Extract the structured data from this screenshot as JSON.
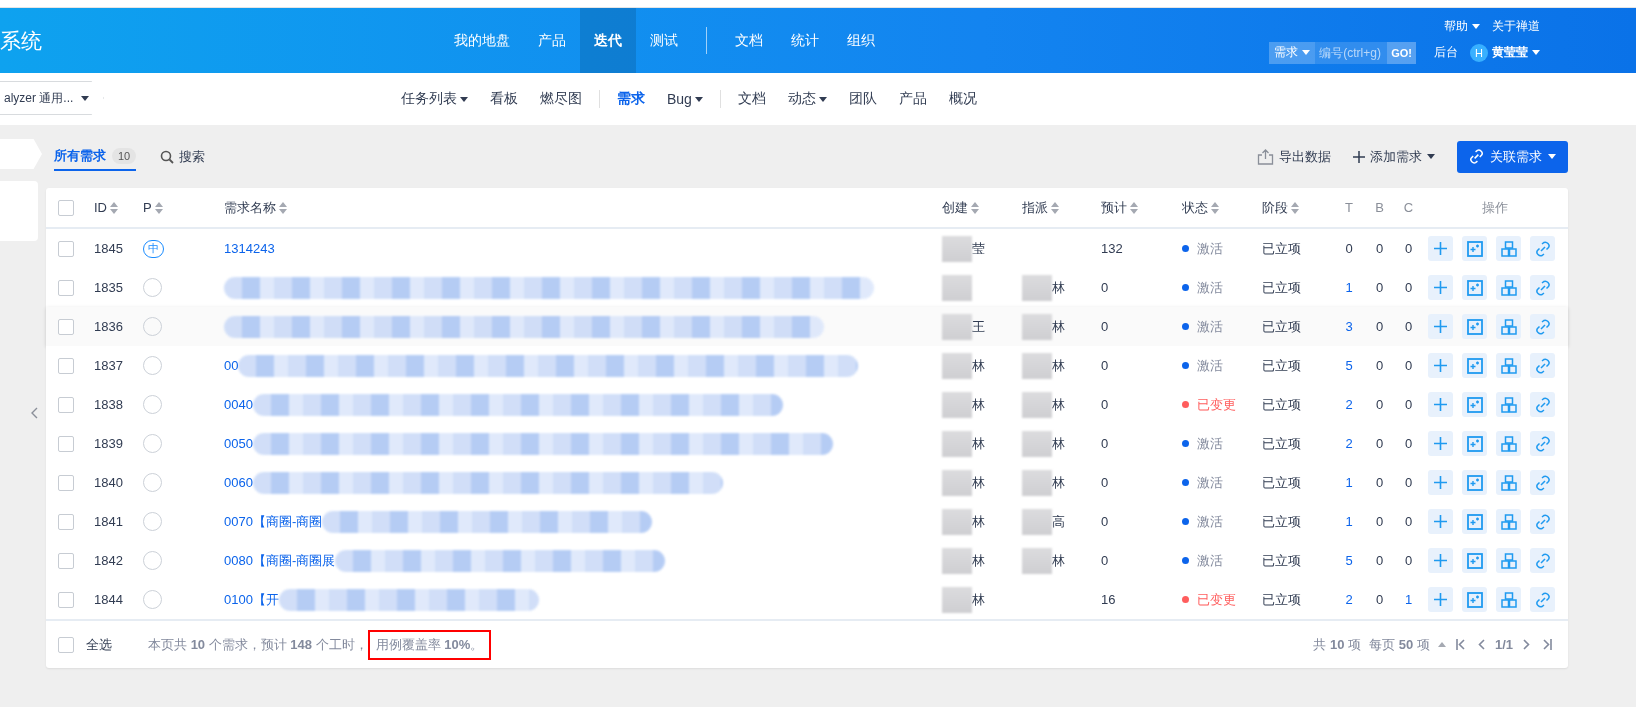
{
  "header": {
    "brand": "系统",
    "nav": [
      {
        "label": "我的地盘",
        "selected": false
      },
      {
        "label": "产品",
        "selected": false
      },
      {
        "label": "迭代",
        "selected": true
      },
      {
        "label": "测试",
        "selected": false
      },
      {
        "kind": "divider"
      },
      {
        "label": "文档",
        "selected": false
      },
      {
        "label": "统计",
        "selected": false
      },
      {
        "label": "组织",
        "selected": false
      }
    ],
    "help": "帮助",
    "about": "关于禅道",
    "search_type": "需求",
    "search": {
      "placeholder": "编号(ctrl+g)"
    },
    "go": "GO!",
    "admin": "后台",
    "avatar": "H",
    "user": "黄莹莹"
  },
  "subnav": {
    "project": "alyzer 通用...",
    "items": [
      {
        "label": "任务列表",
        "dropdown": true,
        "selected": false
      },
      {
        "label": "看板",
        "dropdown": false,
        "selected": false
      },
      {
        "label": "燃尽图",
        "dropdown": false,
        "selected": false
      },
      {
        "kind": "divider"
      },
      {
        "label": "需求",
        "dropdown": false,
        "selected": true
      },
      {
        "label": "Bug",
        "dropdown": true,
        "selected": false
      },
      {
        "kind": "divider"
      },
      {
        "label": "文档",
        "dropdown": false,
        "selected": false
      },
      {
        "label": "动态",
        "dropdown": true,
        "selected": false
      },
      {
        "label": "团队",
        "dropdown": false,
        "selected": false
      },
      {
        "label": "产品",
        "dropdown": false,
        "selected": false
      },
      {
        "label": "概况",
        "dropdown": false,
        "selected": false
      }
    ]
  },
  "select_all_checked": false,
  "toolbar": {
    "tabs": [
      {
        "label": "所有需求",
        "count": "10",
        "selected": true
      }
    ],
    "search": "搜索",
    "export": "导出数据",
    "add": "添加需求",
    "link": "关联需求"
  },
  "table": {
    "columns": [
      {
        "label": "ID",
        "sortable": true
      },
      {
        "label": "P",
        "sortable": true
      },
      {
        "label": "需求名称",
        "sortable": true
      },
      {
        "label": "创建",
        "sortable": true
      },
      {
        "label": "指派",
        "sortable": true
      },
      {
        "label": "预计",
        "sortable": true
      },
      {
        "label": "状态",
        "sortable": true
      },
      {
        "label": "阶段",
        "sortable": true
      },
      {
        "label": "T",
        "sortable": false
      },
      {
        "label": "B",
        "sortable": false
      },
      {
        "label": "C",
        "sortable": false
      },
      {
        "label": "操作",
        "sortable": false
      }
    ],
    "rows": [
      {
        "checked": false,
        "id": "1845",
        "priority": "中",
        "name": "1314243",
        "name_redacted": false,
        "creator": "莹",
        "creator_redacted": true,
        "assignee": "",
        "assignee_redacted": false,
        "estimate": "132",
        "status": "激活",
        "color": "#0c64eb",
        "alert": false,
        "stage": "已立项",
        "t": "0",
        "b": "0",
        "c": "0",
        "highlighted": false
      },
      {
        "checked": false,
        "id": "1835",
        "priority": "",
        "name": "",
        "name_redacted": true,
        "creator": "",
        "creator_redacted": true,
        "assignee": "林",
        "assignee_redacted": true,
        "estimate": "0",
        "status": "激活",
        "color": "#0c64eb",
        "alert": false,
        "stage": "已立项",
        "t": "1",
        "b": "0",
        "c": "0",
        "highlighted": false
      },
      {
        "checked": false,
        "id": "1836",
        "priority": "",
        "name": "",
        "name_redacted": true,
        "creator": "王",
        "creator_redacted": true,
        "assignee": "林",
        "assignee_redacted": true,
        "estimate": "0",
        "status": "激活",
        "color": "#0c64eb",
        "alert": false,
        "stage": "已立项",
        "t": "3",
        "b": "0",
        "c": "0",
        "highlighted": true
      },
      {
        "checked": false,
        "id": "1837",
        "priority": "",
        "name": "00",
        "name_redacted": true,
        "creator": "林",
        "creator_redacted": true,
        "assignee": "林",
        "assignee_redacted": true,
        "estimate": "0",
        "status": "激活",
        "color": "#0c64eb",
        "alert": false,
        "stage": "已立项",
        "t": "5",
        "b": "0",
        "c": "0",
        "highlighted": false
      },
      {
        "checked": false,
        "id": "1838",
        "priority": "",
        "name": "0040",
        "name_redacted": true,
        "creator": "林",
        "creator_redacted": true,
        "assignee": "林",
        "assignee_redacted": true,
        "estimate": "0",
        "status": "已变更",
        "color": "#ff5d5d",
        "alert": true,
        "stage": "已立项",
        "t": "2",
        "b": "0",
        "c": "0",
        "highlighted": false
      },
      {
        "checked": false,
        "id": "1839",
        "priority": "",
        "name": "0050",
        "name_redacted": true,
        "creator": "林",
        "creator_redacted": true,
        "assignee": "林",
        "assignee_redacted": true,
        "estimate": "0",
        "status": "激活",
        "color": "#0c64eb",
        "alert": false,
        "stage": "已立项",
        "t": "2",
        "b": "0",
        "c": "0",
        "highlighted": false
      },
      {
        "checked": false,
        "id": "1840",
        "priority": "",
        "name": "0060",
        "name_redacted": true,
        "creator": "林",
        "creator_redacted": true,
        "assignee": "林",
        "assignee_redacted": true,
        "estimate": "0",
        "status": "激活",
        "color": "#0c64eb",
        "alert": false,
        "stage": "已立项",
        "t": "1",
        "b": "0",
        "c": "0",
        "highlighted": false
      },
      {
        "checked": false,
        "id": "1841",
        "priority": "",
        "name": "0070【商圈-商圈",
        "name_redacted": true,
        "creator": "林",
        "creator_redacted": true,
        "assignee": "高",
        "assignee_redacted": true,
        "estimate": "0",
        "status": "激活",
        "color": "#0c64eb",
        "alert": false,
        "stage": "已立项",
        "t": "1",
        "b": "0",
        "c": "0",
        "highlighted": false
      },
      {
        "checked": false,
        "id": "1842",
        "priority": "",
        "name": "0080【商圈-商圈展",
        "name_redacted": true,
        "creator": "林",
        "creator_redacted": true,
        "assignee": "林",
        "assignee_redacted": true,
        "estimate": "0",
        "status": "激活",
        "color": "#0c64eb",
        "alert": false,
        "stage": "已立项",
        "t": "5",
        "b": "0",
        "c": "0",
        "highlighted": false
      },
      {
        "checked": false,
        "id": "1844",
        "priority": "",
        "name": "0100【开",
        "name_redacted": true,
        "creator": "林",
        "creator_redacted": true,
        "assignee": "",
        "assignee_redacted": false,
        "estimate": "16",
        "status": "已变更",
        "color": "#ff5d5d",
        "alert": true,
        "stage": "已立项",
        "t": "2",
        "b": "0",
        "c": "1",
        "highlighted": false
      }
    ]
  },
  "footer": {
    "select_all": "全选",
    "summary": "本页共 **10** 个需求，预计 **148** 个工时，",
    "coverage": "用例覆盖率 **10%**。",
    "total": "共 **10** 项",
    "per_page": "每页 **50** 项",
    "page": "1/1"
  }
}
